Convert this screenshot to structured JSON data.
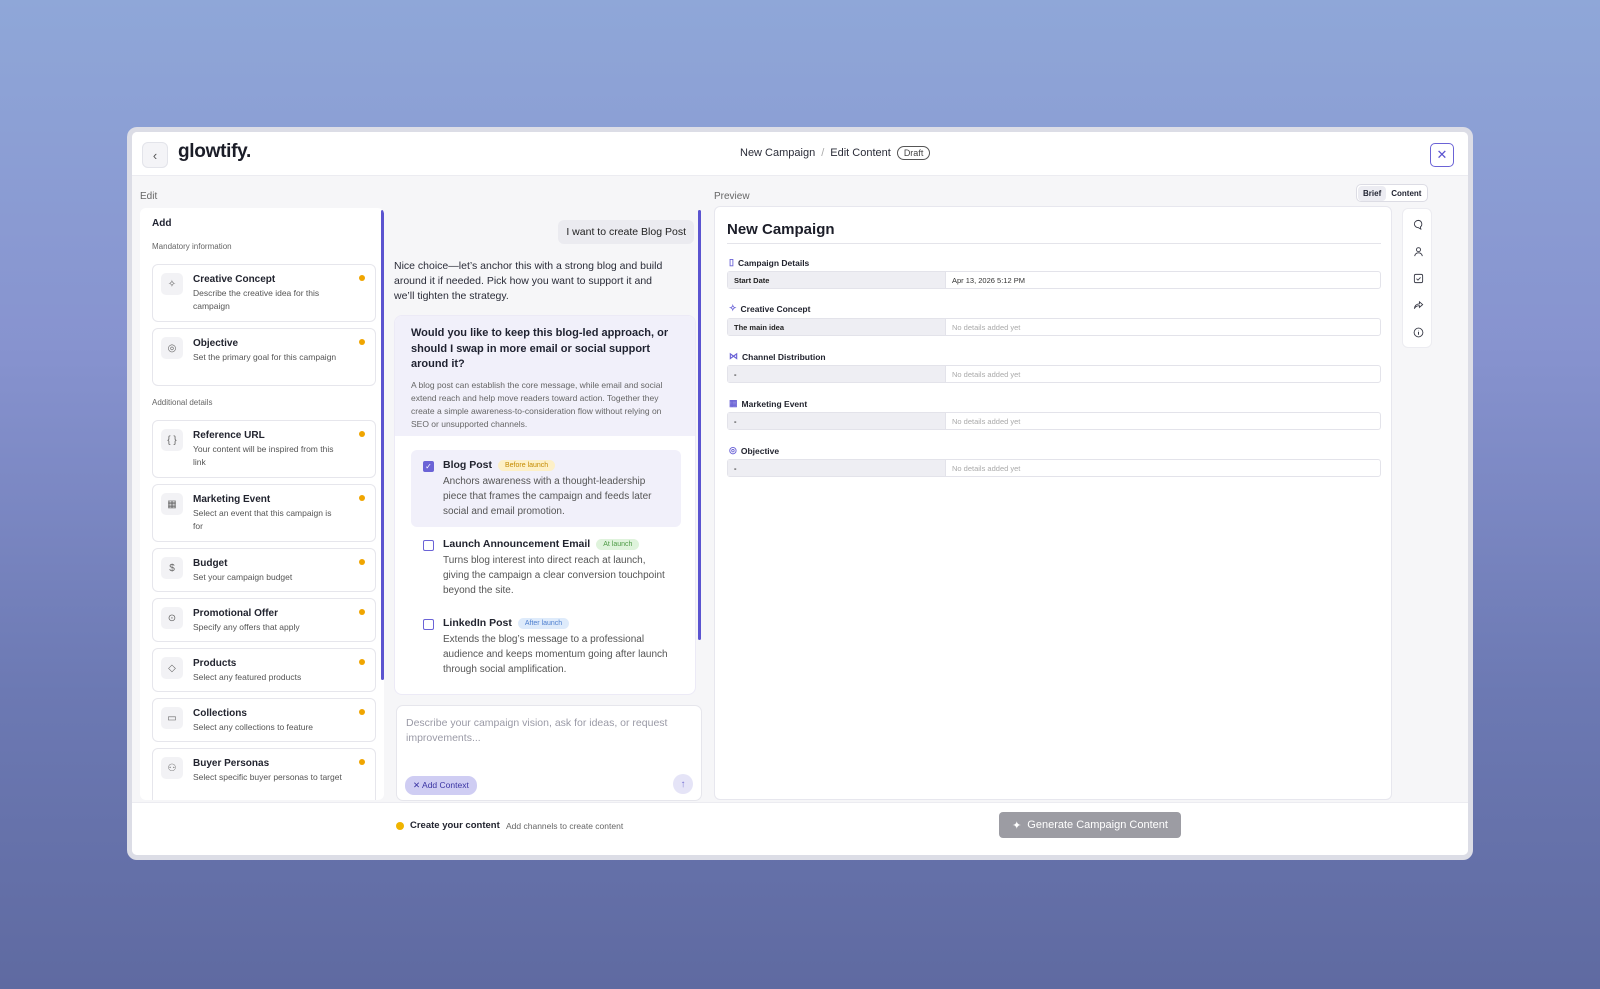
{
  "app": {
    "logo": "glowtify.",
    "back_icon": "‹",
    "close_icon": "✕"
  },
  "breadcrumb": {
    "item1": "New Campaign",
    "sep": "/",
    "item2": "Edit Content",
    "badge": "Draft"
  },
  "labels": {
    "edit": "Edit",
    "preview": "Preview"
  },
  "view_toggle": {
    "brief": "Brief",
    "content": "Content",
    "selected": "Brief"
  },
  "left": {
    "add_title": "Add",
    "mandatory_title": "Mandatory information",
    "additional_title": "Additional details",
    "mandatory": [
      {
        "title": "Creative Concept",
        "desc": "Describe the creative idea for this campaign",
        "icon": "lightbulb-icon",
        "glyph": "✧"
      },
      {
        "title": "Objective",
        "desc": "Set the primary goal for this campaign",
        "icon": "target-icon",
        "glyph": "◎"
      }
    ],
    "additional": [
      {
        "title": "Reference URL",
        "desc": "Your content will be inspired from this link",
        "icon": "code-icon",
        "glyph": "{ }"
      },
      {
        "title": "Marketing Event",
        "desc": "Select an event that this campaign is for",
        "icon": "calendar-icon",
        "glyph": "▦"
      },
      {
        "title": "Budget",
        "desc": "Set your campaign budget",
        "icon": "dollar-icon",
        "glyph": "$"
      },
      {
        "title": "Promotional Offer",
        "desc": "Specify any offers that apply",
        "icon": "offer-icon",
        "glyph": "⊙"
      },
      {
        "title": "Products",
        "desc": "Select any featured products",
        "icon": "tag-icon",
        "glyph": "◇"
      },
      {
        "title": "Collections",
        "desc": "Select any collections to feature",
        "icon": "archive-icon",
        "glyph": "▭"
      },
      {
        "title": "Buyer Personas",
        "desc": "Select specific buyer personas to target",
        "icon": "users-icon",
        "glyph": "⚇"
      }
    ]
  },
  "chat": {
    "user_message": "I want to create Blog Post",
    "assistant_message": "Nice choice—let’s anchor this with a strong blog and build around it if needed. Pick how you want to support it and we’ll tighten the strategy.",
    "question": "Would you like to keep this blog-led approach, or should I swap in more email or social support around it?",
    "question_detail": "A blog post can establish the core message, while email and social extend reach and help move readers toward action. Together they create a simple awareness-to-consideration flow without relying on SEO or unsupported channels.",
    "options": [
      {
        "title": "Blog Post",
        "tag": "Before launch",
        "desc": "Anchors awareness with a thought-leadership piece that frames the campaign and feeds later social and email promotion.",
        "checked": true
      },
      {
        "title": "Launch Announcement Email",
        "tag": "At launch",
        "desc": "Turns blog interest into direct reach at launch, giving the campaign a clear conversion touchpoint beyond the site.",
        "checked": false
      },
      {
        "title": "LinkedIn Post",
        "tag": "After launch",
        "desc": "Extends the blog’s message to a professional audience and keeps momentum going after launch through social amplification.",
        "checked": false
      }
    ],
    "input_placeholder": "Describe your campaign vision, ask for ideas, or request improvements...",
    "add_context": "Add Context"
  },
  "preview": {
    "title": "New Campaign",
    "empty_text": "No details added yet",
    "sections": [
      {
        "title": "Campaign Details",
        "icon": "document-icon",
        "glyph": "▯",
        "key": "Start Date",
        "value": "Apr 13, 2026 5:12 PM"
      },
      {
        "title": "Creative Concept",
        "icon": "lightbulb-icon",
        "glyph": "✧",
        "key": "The main idea",
        "value": "No details added yet"
      },
      {
        "title": "Channel Distribution",
        "icon": "share-icon",
        "glyph": "⋈",
        "key": "-",
        "value": "No details added yet"
      },
      {
        "title": "Marketing Event",
        "icon": "calendar-icon",
        "glyph": "▦",
        "key": "-",
        "value": "No details added yet"
      },
      {
        "title": "Objective",
        "icon": "target-icon",
        "glyph": "◎",
        "key": "-",
        "value": "No details added yet"
      }
    ]
  },
  "rail": [
    "comment-icon",
    "person-icon",
    "checklist-icon",
    "share-icon",
    "info-icon"
  ],
  "footer": {
    "status_title": "Create your content",
    "status_sub": "Add channels to create content",
    "generate": "Generate Campaign Content"
  },
  "colors": {
    "accent": "#5b54d0",
    "warning": "#f0a500",
    "button_disabled": "#9c9ca3"
  }
}
